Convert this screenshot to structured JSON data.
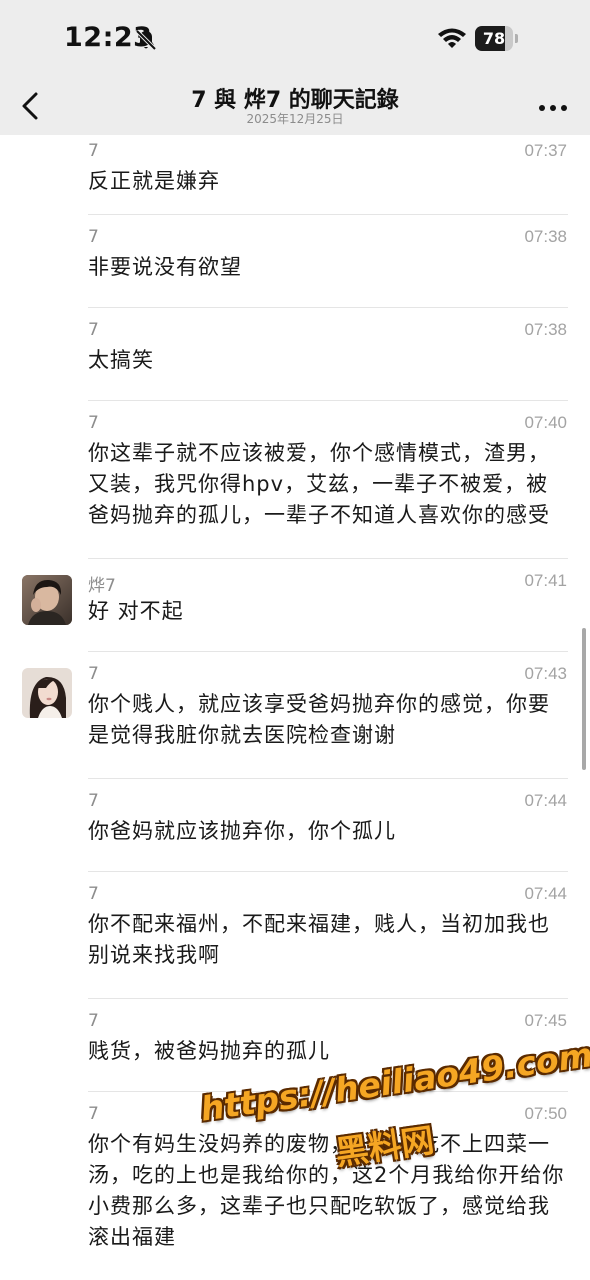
{
  "status_bar": {
    "time": "12:23",
    "battery_level": "78",
    "battery_fraction": 0.78,
    "icons": [
      "bell-slash-icon",
      "wifi-icon",
      "battery-icon"
    ]
  },
  "nav": {
    "title": "7 與 烨7 的聊天記錄",
    "subtitle": "2025年12月25日",
    "icons": [
      "chevron-left-icon",
      "more-dots-icon"
    ]
  },
  "messages": [
    {
      "sender": "7",
      "time": "07:37",
      "text": "反正就是嫌弃",
      "avatar": false
    },
    {
      "sender": "7",
      "time": "07:38",
      "text": "非要说没有欲望",
      "avatar": false
    },
    {
      "sender": "7",
      "time": "07:38",
      "text": "太搞笑",
      "avatar": false
    },
    {
      "sender": "7",
      "time": "07:40",
      "text": "你这辈子就不应该被爱，你个感情模式，渣男，又装，我咒你得hpv，艾兹，一辈子不被爱，被爸妈抛弃的孤儿，一辈子不知道人喜欢你的感受",
      "avatar": false
    },
    {
      "sender": "烨7",
      "time": "07:41",
      "text": "好 对不起",
      "avatar": true,
      "avatar_style": "male-photo"
    },
    {
      "sender": "7",
      "time": "07:43",
      "text": "你个贱人，就应该享受爸妈抛弃你的感觉，你要是觉得我脏你就去医院检查谢谢",
      "avatar": true,
      "avatar_style": "female-photo"
    },
    {
      "sender": "7",
      "time": "07:44",
      "text": "你爸妈就应该抛弃你，你个孤儿",
      "avatar": false
    },
    {
      "sender": "7",
      "time": "07:44",
      "text": "你不配来福州，不配来福建，贱人，当初加我也别说来找我啊",
      "avatar": false
    },
    {
      "sender": "7",
      "time": "07:45",
      "text": "贱货，被爸妈抛弃的孤儿",
      "avatar": false
    },
    {
      "sender": "7",
      "time": "07:50",
      "text": "你个有妈生没妈养的废物，一辈子吃不上四菜一汤，吃的上也是我给你的，这2个月我给你开给你小费那么多，这辈子也只配吃软饭了，感觉给我滚出福建",
      "avatar": false
    }
  ],
  "watermark": {
    "url": "https://heiliao49.com",
    "text": "黑料网"
  },
  "colors": {
    "header_bg": "#ededed",
    "list_bg": "#ffffff",
    "separator": "#e5e5e5",
    "meta_text": "#8d8d8d",
    "watermark": "#f5a623"
  }
}
